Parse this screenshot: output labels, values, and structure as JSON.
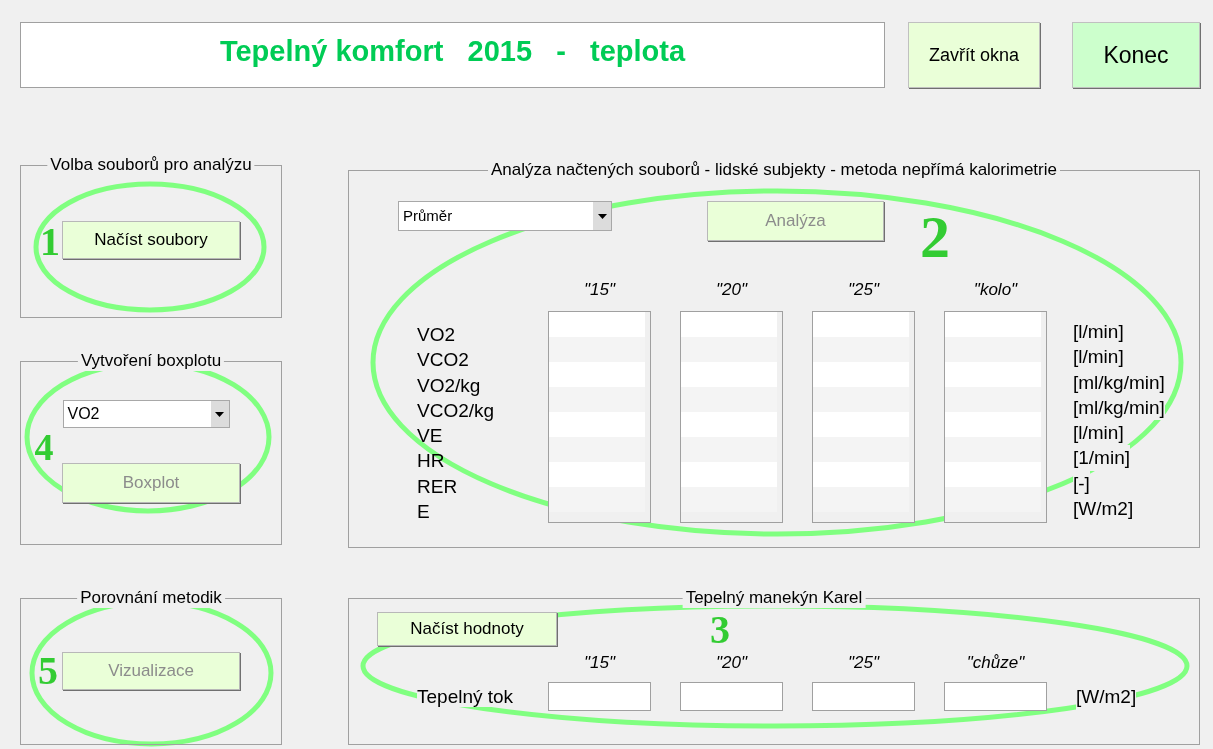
{
  "header": {
    "title": "Tepelný komfort   2015   -   teplota"
  },
  "top_buttons": [
    {
      "label": "Zavřít okna",
      "kind": "small"
    },
    {
      "label": "Konec",
      "kind": "large"
    }
  ],
  "file_panel": {
    "title": "Volba souborů pro analýzu",
    "button": {
      "label": "Načíst soubory",
      "disabled": false
    },
    "annotation": "1"
  },
  "boxplot_panel": {
    "title": "Vytvoření boxplotu",
    "dropdown": {
      "value": "VO2"
    },
    "button": {
      "label": "Boxplot",
      "disabled": true
    },
    "annotation": "4"
  },
  "compare_panel": {
    "title": "Porovnání metodik",
    "button": {
      "label": "Vizualizace",
      "disabled": true
    },
    "annotation": "5"
  },
  "analysis_panel": {
    "title": "Analýza načtených souborů - lidské subjekty - metoda nepřímá kalorimetrie",
    "dropdown": {
      "value": "Průměr"
    },
    "button": {
      "label": "Analýza",
      "disabled": true
    },
    "columns": [
      "\"15\"",
      "\"20\"",
      "\"25\"",
      "\"kolo\""
    ],
    "rows": [
      {
        "label": "VO2",
        "unit": "[l/min]"
      },
      {
        "label": "VCO2",
        "unit": "[l/min]"
      },
      {
        "label": "VO2/kg",
        "unit": "[ml/kg/min]"
      },
      {
        "label": "VCO2/kg",
        "unit": "[ml/kg/min]"
      },
      {
        "label": "VE",
        "unit": "[l/min]"
      },
      {
        "label": "HR",
        "unit": "[1/min]"
      },
      {
        "label": "RER",
        "unit": "[-]"
      },
      {
        "label": "E",
        "unit": "[W/m2]"
      }
    ],
    "annotation": "2"
  },
  "manikin_panel": {
    "title": "Tepelný manekýn Karel",
    "button": {
      "label": "Načíst hodnoty",
      "disabled": false
    },
    "columns": [
      "\"15\"",
      "\"20\"",
      "\"25\"",
      "\"chůze\""
    ],
    "row_label": "Tepelný tok",
    "unit": "[W/m2]",
    "annotation": "3"
  }
}
